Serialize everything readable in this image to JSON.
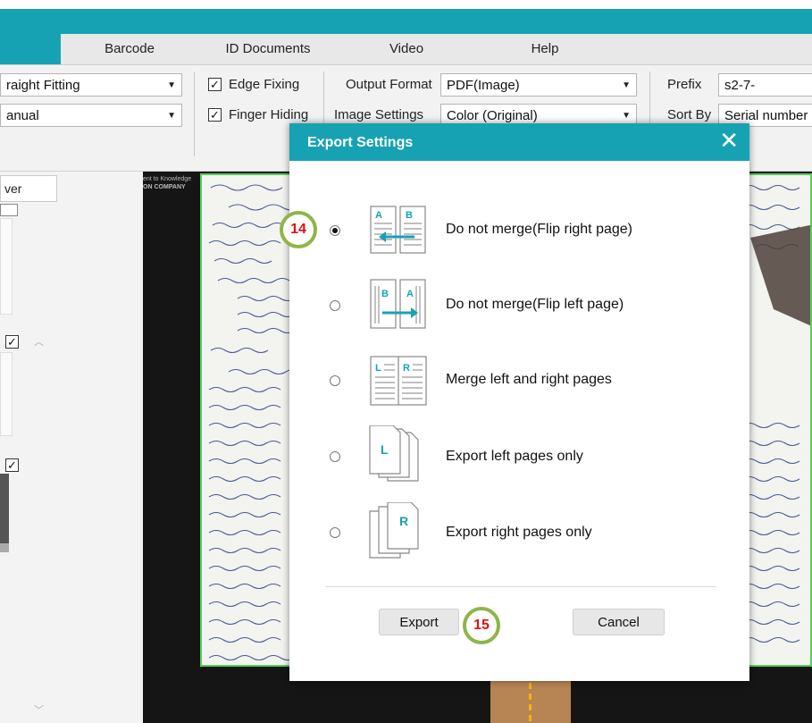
{
  "menu": {
    "items": [
      "Barcode",
      "ID Documents",
      "Video",
      "Help"
    ]
  },
  "toolbar": {
    "fitting_value": "raight Fitting",
    "mode_value": "anual",
    "edge_fixing_label": "Edge Fixing",
    "finger_hiding_label": "Finger Hiding",
    "output_format_label": "Output Format",
    "output_format_value": "PDF(Image)",
    "image_settings_label": "Image Settings",
    "image_settings_value": "Color (Original)",
    "prefix_label": "Prefix",
    "prefix_value": "s2-7-",
    "sort_by_label": "Sort By",
    "sort_by_value": "Serial number"
  },
  "left_panel": {
    "tab_label": "ver"
  },
  "document": {
    "watermark_line1": "ent to Knowledge",
    "watermark_line2": "ON COMPANY"
  },
  "dialog": {
    "title": "Export Settings",
    "options": [
      {
        "label": "Do not merge(Flip right page)",
        "selected": true
      },
      {
        "label": "Do not merge(Flip left page)",
        "selected": false
      },
      {
        "label": "Merge left and right pages",
        "selected": false
      },
      {
        "label": "Export left pages only",
        "selected": false
      },
      {
        "label": "Export right pages only",
        "selected": false
      }
    ],
    "export_label": "Export",
    "cancel_label": "Cancel"
  },
  "annotations": {
    "badge_14": "14",
    "badge_15": "15"
  },
  "colors": {
    "accent": "#17a2b3",
    "badge_ring": "#8fb548",
    "badge_text": "#e01010",
    "page_border": "#55d155"
  },
  "icons": [
    "check-icon",
    "dropdown-arrow-icon",
    "close-icon",
    "flip-right-page-icon",
    "flip-left-page-icon",
    "merge-pages-icon",
    "left-pages-icon",
    "right-pages-icon"
  ]
}
